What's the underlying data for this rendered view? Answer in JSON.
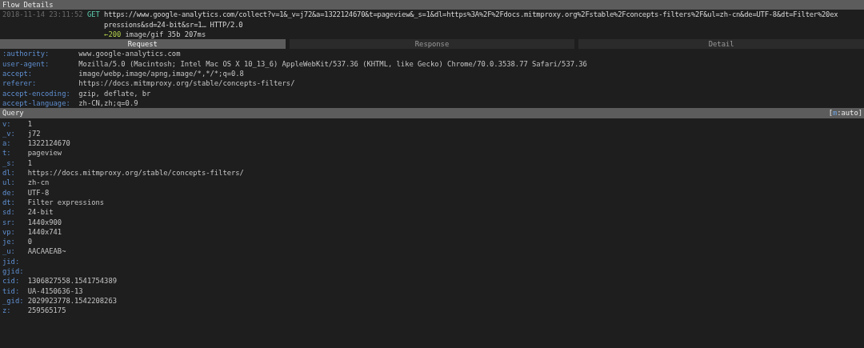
{
  "title": "Flow Details",
  "flow": {
    "timestamp": "2018-11-14 23:11:52",
    "method": "GET",
    "url_lines": [
      "https://www.google-analytics.com/collect?v=1&_v=j72&a=1322124670&t=pageview&_s=1&dl=https%3A%2F%2Fdocs.mitmproxy.org%2Fstable%2Fconcepts-filters%2F&ul=zh-cn&de=UTF-8&dt=Filter%20ex",
      "pressions&sd=24-bit&sr=1… HTTP/2.0"
    ],
    "status_arrow": "←",
    "status_code": "200",
    "response_summary": "image/gif 35b 207ms"
  },
  "tabs": [
    {
      "label": "Request",
      "selected": true
    },
    {
      "label": "Response",
      "selected": false
    },
    {
      "label": "Detail",
      "selected": false
    }
  ],
  "headers": [
    {
      "name": ":authority:",
      "value": "www.google-analytics.com"
    },
    {
      "name": "user-agent:",
      "value": "Mozilla/5.0 (Macintosh; Intel Mac OS X 10_13_6) AppleWebKit/537.36 (KHTML, like Gecko) Chrome/70.0.3538.77 Safari/537.36"
    },
    {
      "name": "accept:",
      "value": "image/webp,image/apng,image/*,*/*;q=0.8"
    },
    {
      "name": "referer:",
      "value": "https://docs.mitmproxy.org/stable/concepts-filters/"
    },
    {
      "name": "accept-encoding:",
      "value": "gzip, deflate, br"
    },
    {
      "name": "accept-language:",
      "value": "zh-CN,zh;q=0.9"
    }
  ],
  "query": {
    "title": "Query",
    "mode_open": "[",
    "mode_key": "m",
    "mode_rest": ":auto]",
    "rows": [
      {
        "name": "v:",
        "value": "1"
      },
      {
        "name": "_v:",
        "value": "j72"
      },
      {
        "name": "a:",
        "value": "1322124670"
      },
      {
        "name": "t:",
        "value": "pageview"
      },
      {
        "name": "_s:",
        "value": "1"
      },
      {
        "name": "dl:",
        "value": "https://docs.mitmproxy.org/stable/concepts-filters/"
      },
      {
        "name": "ul:",
        "value": "zh-cn"
      },
      {
        "name": "de:",
        "value": "UTF-8"
      },
      {
        "name": "dt:",
        "value": "Filter expressions"
      },
      {
        "name": "sd:",
        "value": "24-bit"
      },
      {
        "name": "sr:",
        "value": "1440x900"
      },
      {
        "name": "vp:",
        "value": "1440x741"
      },
      {
        "name": "je:",
        "value": "0"
      },
      {
        "name": "_u:",
        "value": "AACAAEAB~"
      },
      {
        "name": "jid:"
      },
      {
        "name": "gjid:"
      },
      {
        "name": "cid:",
        "value": "1306827558.1541754389"
      },
      {
        "name": "tid:",
        "value": "UA-4150636-13"
      },
      {
        "name": "_gid:",
        "value": "2029923778.1542208263"
      },
      {
        "name": "z:",
        "value": "259565175"
      }
    ]
  }
}
